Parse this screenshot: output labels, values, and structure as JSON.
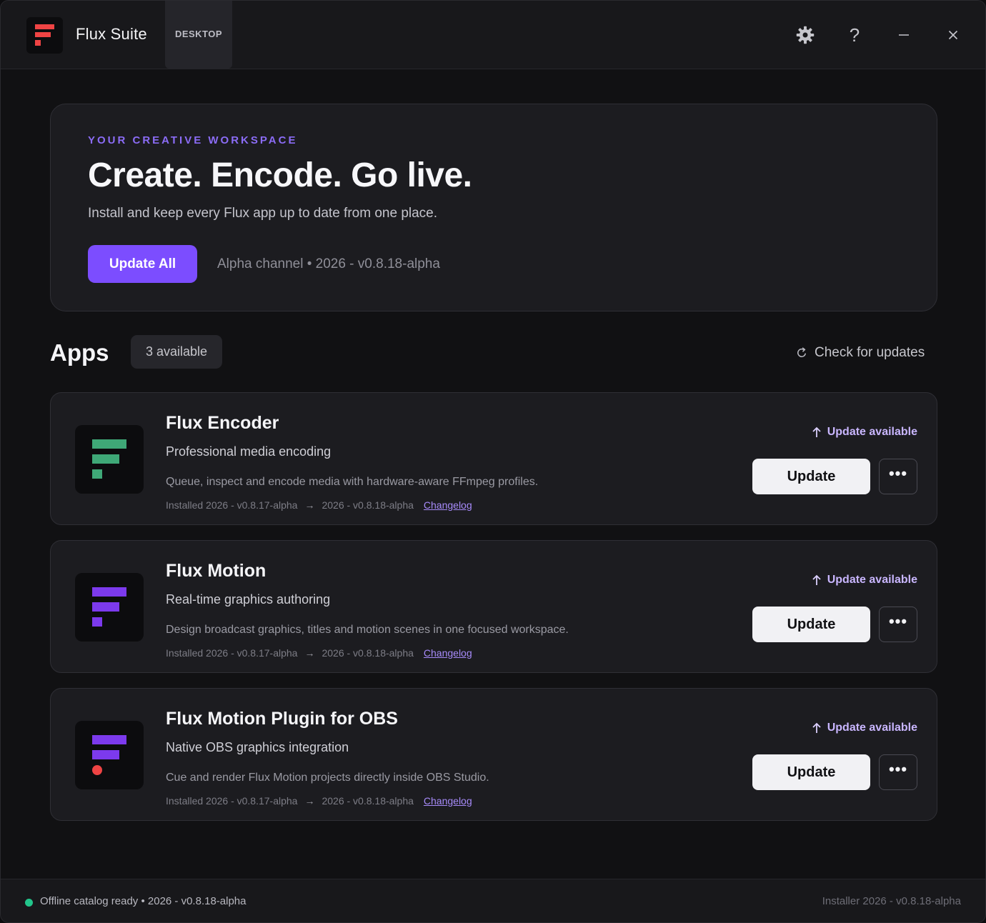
{
  "app": {
    "name": "Flux Suite",
    "edition_chip": "DESKTOP",
    "brand_color": "#ef4444"
  },
  "titlebar": {
    "settings_icon": "gear-icon",
    "help_label": "?",
    "minimize_icon": "minimize-icon",
    "close_icon": "close-icon"
  },
  "hero": {
    "eyebrow": "YOUR CREATIVE WORKSPACE",
    "title": "Create. Encode. Go live.",
    "subtitle": "Install and keep every Flux app up to date from one place.",
    "update_all_label": "Update All",
    "channel_text": "Alpha channel • 2026 - v0.8.18-alpha",
    "accent_color": "#7c4dff"
  },
  "apps_section": {
    "title": "Apps",
    "count_label": "3 available",
    "check_updates_label": "Check for updates"
  },
  "apps": [
    {
      "name": "Flux Encoder",
      "tagline": "Professional media encoding",
      "description": "Queue, inspect and encode media with hardware-aware FFmpeg profiles.",
      "installed": "Installed 2026 - v0.8.17-alpha",
      "available": "2026 - v0.8.18-alpha",
      "changelog_label": "Changelog",
      "status": "Update available",
      "update_label": "Update",
      "more_label": "•••",
      "icon_color": "#3fa877",
      "icon_variant": "bars-square"
    },
    {
      "name": "Flux Motion",
      "tagline": "Real-time graphics authoring",
      "description": "Design broadcast graphics, titles and motion scenes in one focused workspace.",
      "installed": "Installed 2026 - v0.8.17-alpha",
      "available": "2026 - v0.8.18-alpha",
      "changelog_label": "Changelog",
      "status": "Update available",
      "update_label": "Update",
      "more_label": "•••",
      "icon_color": "#7c3aed",
      "icon_variant": "bars-square"
    },
    {
      "name": "Flux Motion Plugin for OBS",
      "tagline": "Native OBS graphics integration",
      "description": "Cue and render Flux Motion projects directly inside OBS Studio.",
      "installed": "Installed 2026 - v0.8.17-alpha",
      "available": "2026 - v0.8.18-alpha",
      "changelog_label": "Changelog",
      "status": "Update available",
      "update_label": "Update",
      "more_label": "•••",
      "icon_color": "#7c3aed",
      "dot_color": "#ef4444",
      "icon_variant": "bars-dot"
    }
  ],
  "footer": {
    "status_text": "Offline catalog ready • 2026 - v0.8.18-alpha",
    "status_color": "#22c58b",
    "installer_version": "Installer 2026 - v0.8.18-alpha"
  }
}
